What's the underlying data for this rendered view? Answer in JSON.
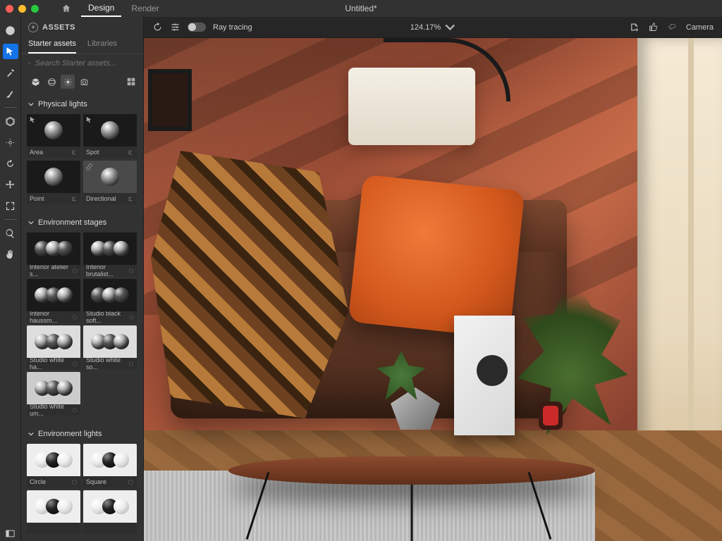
{
  "titlebar": {
    "home_tab": "",
    "design_tab": "Design",
    "render_tab": "Render",
    "document": "Untitled*"
  },
  "assets": {
    "panel_title": "ASSETS",
    "tab_starter": "Starter assets",
    "tab_libraries": "Libraries",
    "search_placeholder": "Search Starter assets..."
  },
  "sections": {
    "physical_lights": "Physical lights",
    "env_stages": "Environment stages",
    "env_lights": "Environment lights"
  },
  "lights": {
    "area": "Area",
    "spot": "Spot",
    "point": "Point",
    "directional": "Directional"
  },
  "stages": {
    "atelier": "Interior atelier s...",
    "brutalist": "Interior brutalist...",
    "haussm": "Interior haussm...",
    "black_soft": "Studio black soft...",
    "white_ha": "Studio white ha...",
    "white_so": "Studio white so...",
    "white_um": "Studio white um..."
  },
  "env_lights": {
    "circle": "Circle",
    "square": "Square"
  },
  "viewbar": {
    "raytracing": "Ray tracing",
    "zoom": "124.17%",
    "camera": "Camera"
  }
}
